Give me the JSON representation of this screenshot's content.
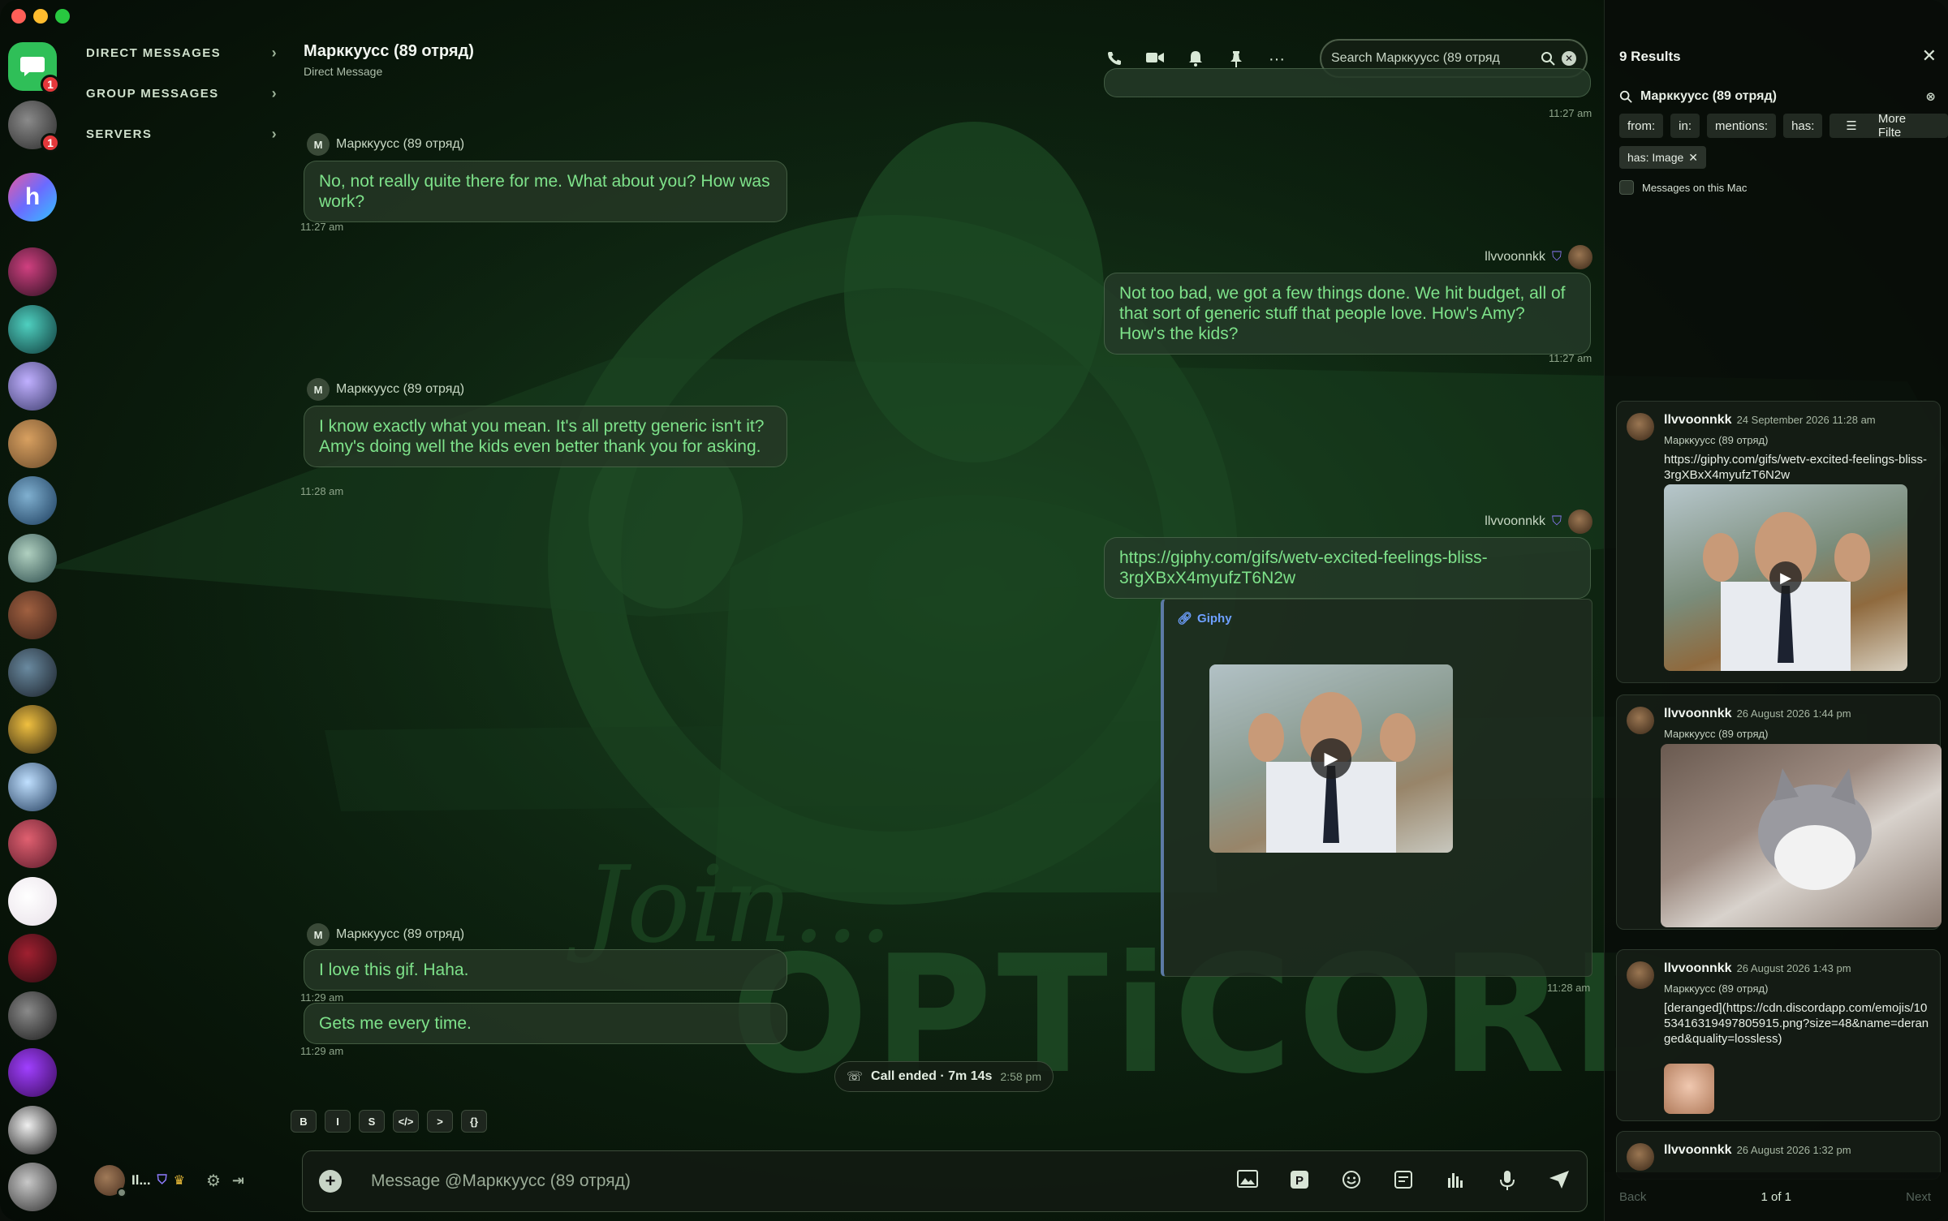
{
  "window": {
    "traffic_colors": [
      "#ff5f57",
      "#febc2e",
      "#28c840"
    ]
  },
  "rail": {
    "home_badge": "1",
    "second_badge": "1",
    "server_icons": [
      {
        "name": "direct-messages-icon"
      },
      {
        "name": "server-avatar"
      },
      {
        "name": "server-h-avatar"
      },
      {
        "name": "server-avatar"
      },
      {
        "name": "server-avatar"
      },
      {
        "name": "server-avatar"
      },
      {
        "name": "server-avatar"
      },
      {
        "name": "server-avatar"
      },
      {
        "name": "server-avatar"
      },
      {
        "name": "server-avatar"
      },
      {
        "name": "server-avatar"
      },
      {
        "name": "server-avatar"
      },
      {
        "name": "server-avatar"
      },
      {
        "name": "server-avatar"
      },
      {
        "name": "server-avatar"
      },
      {
        "name": "server-avatar"
      },
      {
        "name": "server-avatar"
      },
      {
        "name": "server-avatar"
      },
      {
        "name": "server-avatar"
      },
      {
        "name": "server-avatar"
      },
      {
        "name": "server-avatar"
      }
    ]
  },
  "channels": {
    "direct_messages": "DIRECT MESSAGES",
    "group_messages": "GROUP MESSAGES",
    "servers": "SERVERS"
  },
  "user_panel": {
    "name": "Il...",
    "settings_icon": "gear-icon",
    "logout_icon": "logout-icon"
  },
  "header": {
    "title": "Маркκуусс (89 отряд)",
    "subtitle": "Direct Message",
    "search_placeholder": "Search Маркκуусс (89 отряд",
    "icons": [
      "phone-icon",
      "video-icon",
      "bell-icon",
      "pin-icon",
      "more-icon"
    ]
  },
  "messages": {
    "top_partial_ts": "11:27 am",
    "m1": {
      "author": "Маркκуусс (89 отряд)",
      "initial": "M",
      "text": "No, not really quite there for me. What about you? How was work?",
      "ts": "11:27 am"
    },
    "m2": {
      "author": "llvvoonnkk",
      "text": "Not too bad, we got a few things done. We hit budget, all of that sort of generic stuff that people love. How's Amy? How's the kids?",
      "ts": "11:27 am"
    },
    "m3": {
      "author": "Маркκуусс (89 отряд)",
      "initial": "M",
      "text": "I know exactly what you mean. It's all pretty generic isn't it? Amy's doing well the kids even better thank you for asking.",
      "ts": "11:28 am"
    },
    "m4": {
      "author": "llvvoonnkk",
      "text": "https://giphy.com/gifs/wetv-excited-feelings-bliss-3rgXBxX4myufzT6N2w",
      "embed_provider": "Giphy",
      "ts": "11:28 am"
    },
    "m5": {
      "author": "Маркκуусс (89 отряд)",
      "initial": "M",
      "text": "I love this gif. Haha.",
      "ts": "11:29 am"
    },
    "m6": {
      "text": "Gets me every time.",
      "ts": "11:29 am"
    },
    "call": {
      "text": "Call ended · 7m 14s",
      "time": "2:58 pm"
    }
  },
  "format_bar": [
    "B",
    "I",
    "S",
    "</>",
    ">",
    "{}"
  ],
  "composer": {
    "placeholder": "Message @Маркκуусс (89 отряд)",
    "icons": [
      "image-icon",
      "parking-icon",
      "emoji-icon",
      "sticker-icon",
      "chart-icon",
      "microphone-icon",
      "send-icon"
    ]
  },
  "results": {
    "title": "9 Results",
    "query": "Маркκуусс (89 отряд)",
    "filters": [
      "from:",
      "in:",
      "mentions:",
      "has:",
      "More Filte"
    ],
    "chip": "has: Image",
    "mac_option": "Messages on this Mac",
    "cards": [
      {
        "author": "llvvoonnkk",
        "date": "24 September 2026  11:28 am",
        "channel": "Маркκуусс (89 отряд)",
        "text": "https://giphy.com/gifs/wetv-excited-feelings-bliss-3rgXBxX4myufzT6N2w"
      },
      {
        "author": "llvvoonnkk",
        "date": "26 August 2026  1:44 pm",
        "channel": "Маркκуусс (89 отряд)",
        "text": ""
      },
      {
        "author": "llvvoonnkk",
        "date": "26 August 2026  1:43 pm",
        "channel": "Маркκуусс (89 отряд)",
        "text": "[deranged](https://cdn.discordapp.com/emojis/1053416319497805915.png?size=48&name=deranged&quality=lossless)"
      },
      {
        "author": "llvvoonnkk",
        "date": "26 August 2026  1:32 pm",
        "channel": "",
        "text": ""
      }
    ],
    "pager": {
      "back": "Back",
      "page": "1 of 1",
      "next": "Next"
    }
  },
  "colors": {
    "accent_green": "#7ee28a",
    "home_green": "#2fbf58",
    "badge_red": "#e5383b",
    "link_blue": "#6ea0ff"
  }
}
